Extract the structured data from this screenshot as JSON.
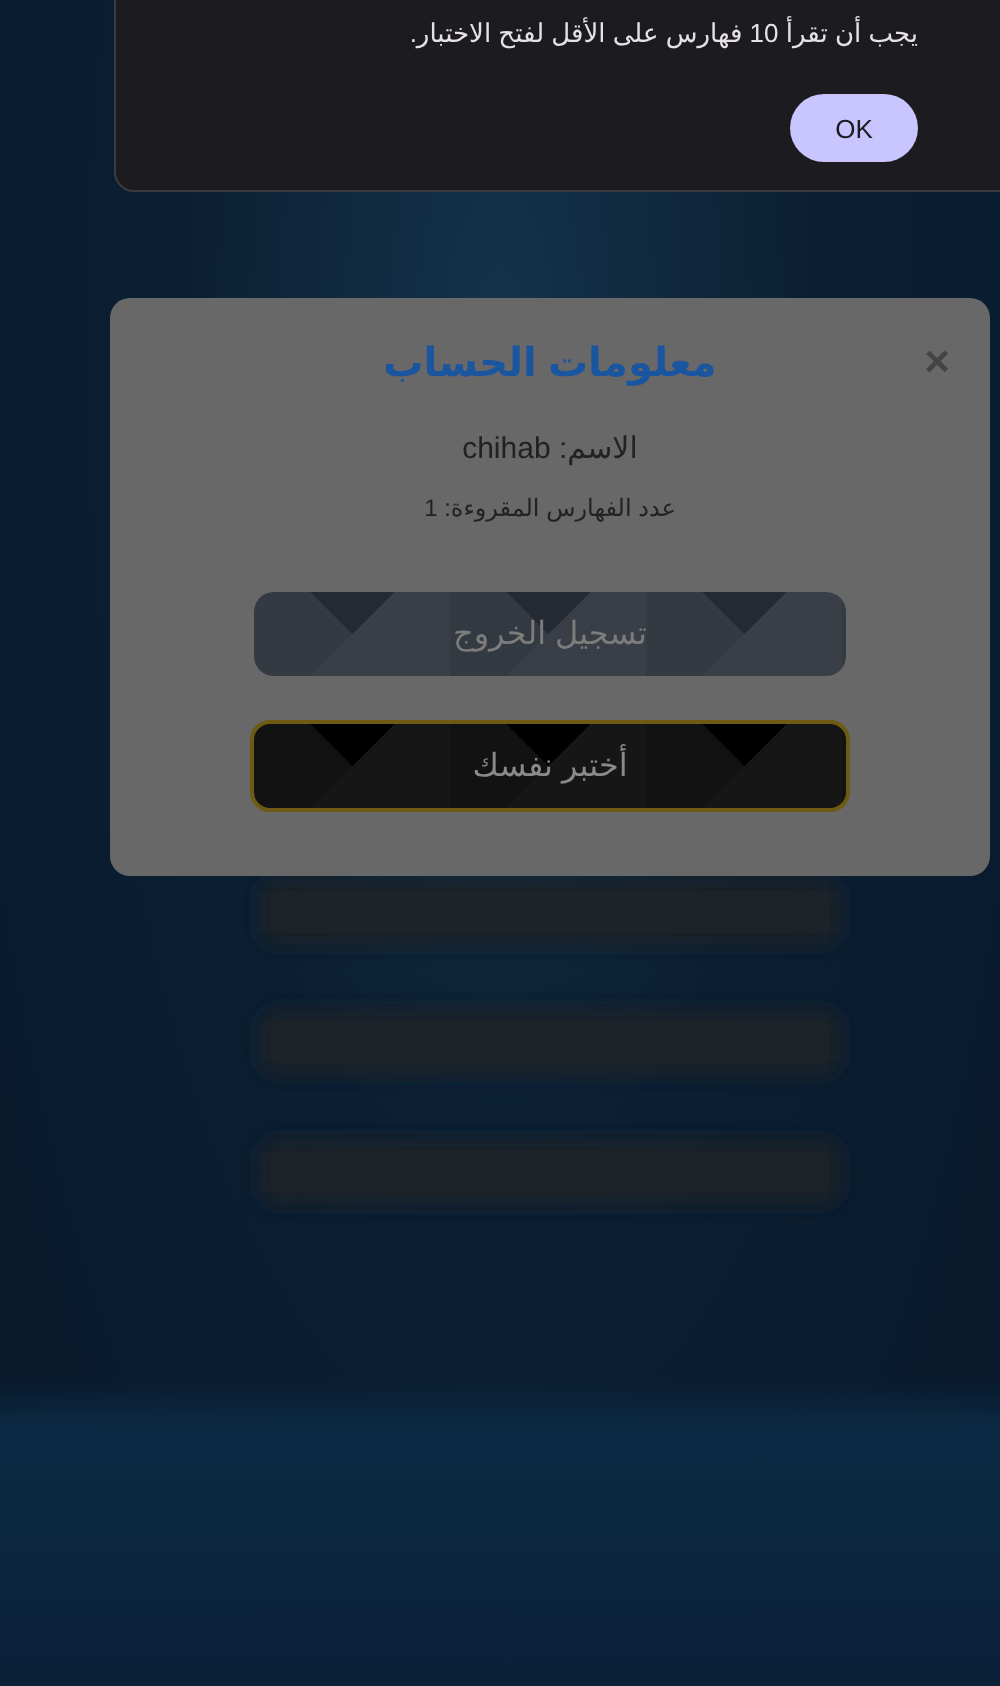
{
  "alert": {
    "message": "يجب أن تقرأ 10 فهارس على الأقل لفتح الاختبار.",
    "button": "OK"
  },
  "modal": {
    "title": "معلومات الحساب",
    "close": "×",
    "name_line": "الاسم: chihab",
    "count_line": "عدد الفهارس المقروءة: 1",
    "buttons": [
      {
        "label": "تسجيل الخروج",
        "kind": "muted"
      },
      {
        "label": "أختبر نفسك",
        "kind": "highlight"
      }
    ]
  }
}
